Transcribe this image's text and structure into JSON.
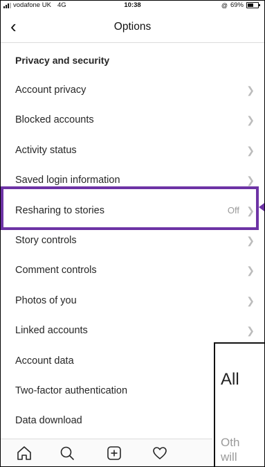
{
  "status_bar": {
    "carrier": "vodafone UK",
    "network": "4G",
    "time": "10:38",
    "battery": "69%",
    "battery_level": 0.69
  },
  "nav": {
    "title": "Options"
  },
  "section_header": "Privacy and security",
  "items": [
    {
      "label": "Account privacy"
    },
    {
      "label": "Blocked accounts"
    },
    {
      "label": "Activity status"
    },
    {
      "label": "Saved login information"
    },
    {
      "label": "Resharing to stories",
      "value": "Off"
    },
    {
      "label": "Story controls"
    },
    {
      "label": "Comment controls"
    },
    {
      "label": "Photos of you"
    },
    {
      "label": "Linked accounts"
    },
    {
      "label": "Account data"
    },
    {
      "label": "Two-factor authentication"
    },
    {
      "label": "Data download"
    }
  ],
  "popup": {
    "title": "All",
    "text_line1": "Oth",
    "text_line2": "will"
  },
  "icons": {
    "back": "chevron-left-icon",
    "chevron": "chevron-right-icon",
    "home": "home-icon",
    "search": "search-icon",
    "add": "add-post-icon",
    "activity": "heart-icon"
  },
  "colors": {
    "highlight": "#6d33a5",
    "chevron": "#bcbcbc"
  }
}
